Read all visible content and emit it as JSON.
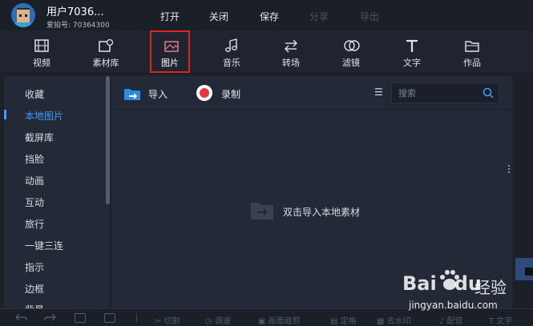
{
  "user": {
    "name": "用户7036...",
    "id_label": "爱拍号: 70364300"
  },
  "top_menu": [
    {
      "label": "打开",
      "enabled": true
    },
    {
      "label": "关闭",
      "enabled": true
    },
    {
      "label": "保存",
      "enabled": true
    },
    {
      "label": "分享",
      "enabled": false
    },
    {
      "label": "导出",
      "enabled": false
    }
  ],
  "media_tools": [
    {
      "label": "视频",
      "icon": "film-icon"
    },
    {
      "label": "素材库",
      "icon": "material-library-icon"
    },
    {
      "label": "图片",
      "icon": "image-icon",
      "active": true
    },
    {
      "label": "音乐",
      "icon": "music-note-icon"
    },
    {
      "label": "转场",
      "icon": "transition-arrows-icon"
    },
    {
      "label": "滤镜",
      "icon": "filter-circles-icon"
    },
    {
      "label": "文字",
      "icon": "text-t-icon"
    },
    {
      "label": "作品",
      "icon": "folder-icon"
    }
  ],
  "sidebar": {
    "items": [
      {
        "label": "收藏"
      },
      {
        "label": "本地图片",
        "active": true
      },
      {
        "label": "截屏库"
      },
      {
        "label": "挡脸"
      },
      {
        "label": "动画"
      },
      {
        "label": "互动"
      },
      {
        "label": "旅行"
      },
      {
        "label": "一键三连"
      },
      {
        "label": "指示"
      },
      {
        "label": "边框"
      },
      {
        "label": "背景"
      }
    ]
  },
  "panel": {
    "import_label": "导入",
    "record_label": "录制",
    "sort_icon": "sort-icon",
    "search_placeholder": "搜索",
    "empty_hint": "双击导入本地素材"
  },
  "bottom_bar": {
    "items": [
      "切割",
      "调速",
      "画面裁剪",
      "定格",
      "去水印",
      "配音",
      "文字"
    ]
  },
  "watermark": {
    "logo": "Bai",
    "logo_suffix": "du",
    "cn": "经验",
    "url": "jingyan.baidu.com"
  },
  "colors": {
    "accent": "#3aa0ff",
    "active_tool_border": "#e02424",
    "record": "#e8373c",
    "import_icon": "#2a8ee6"
  }
}
